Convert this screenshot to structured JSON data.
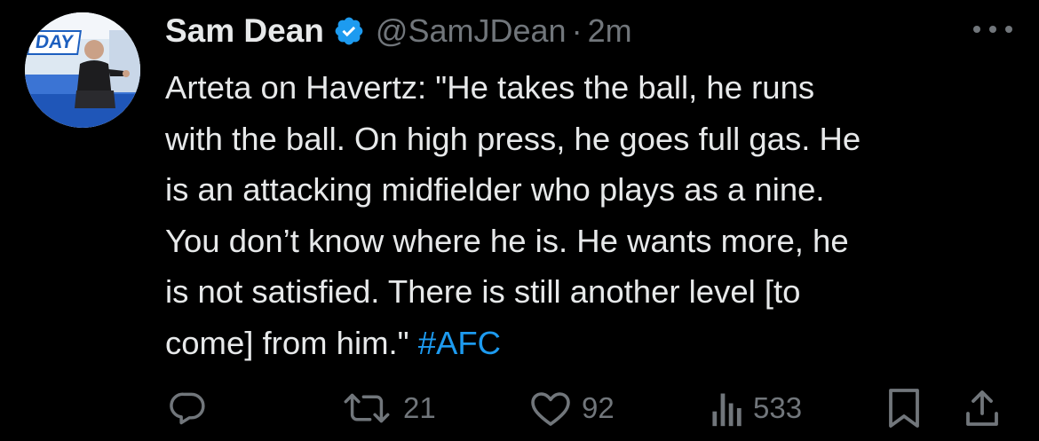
{
  "author": {
    "name": "Sam Dean",
    "handle": "@SamJDean",
    "time": "2m",
    "avatar_text": "DAY"
  },
  "tweet": {
    "lines": [
      "Arteta on Havertz: \"He takes the ball, he runs",
      "with the ball. On high press, he goes full gas. He",
      "is an attacking midfielder who plays as a nine.",
      "You don’t know where he is. He wants more, he",
      "is not satisfied. There is still another level [to"
    ],
    "last_line": "come] from him.\" ",
    "hashtag": "#AFC"
  },
  "actions": {
    "reply_icon": "reply-icon",
    "retweet_icon": "retweet-icon",
    "retweet_count": "21",
    "like_icon": "heart-icon",
    "like_count": "92",
    "views_icon": "views-icon",
    "views_count": "533",
    "bookmark_icon": "bookmark-icon",
    "share_icon": "share-icon"
  },
  "colors": {
    "background": "#000000",
    "text": "#e7e9ea",
    "muted": "#71767b",
    "accent": "#1d9bf0"
  }
}
